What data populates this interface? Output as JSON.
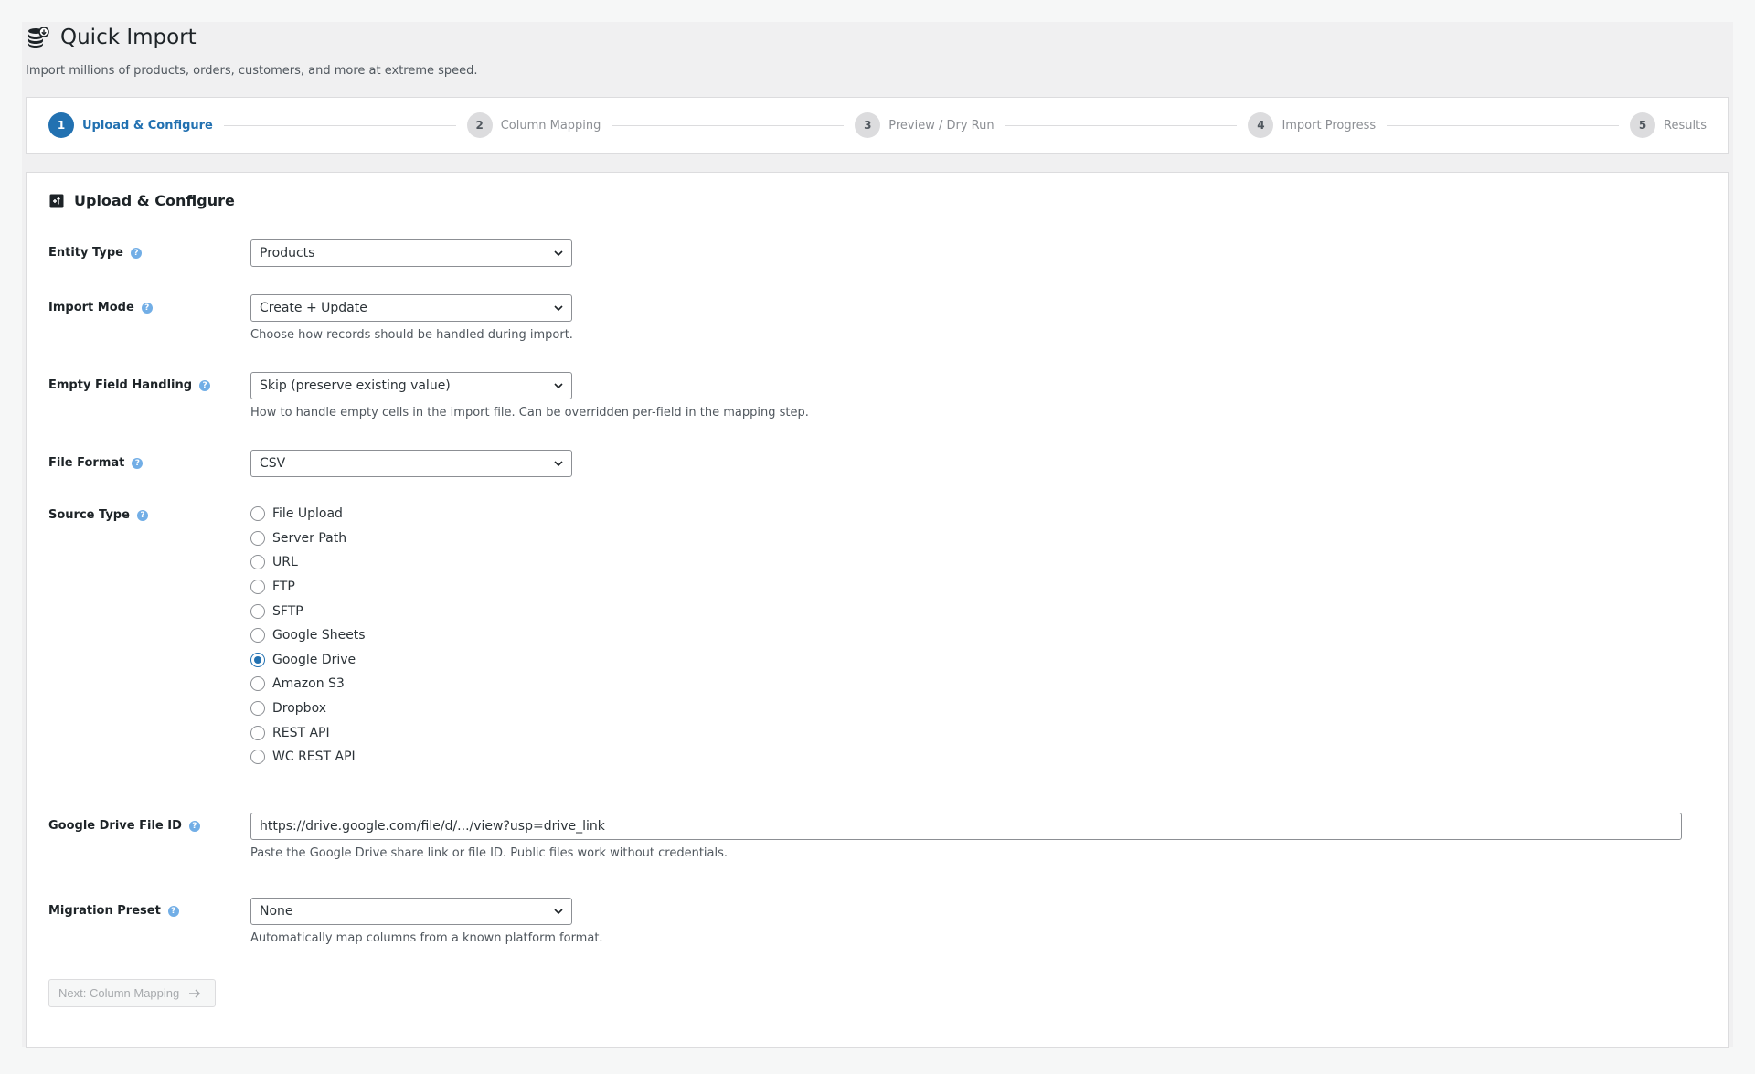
{
  "header": {
    "title": "Quick Import",
    "subtitle": "Import millions of products, orders, customers, and more at extreme speed.",
    "icon": "database-import-icon"
  },
  "stepper": {
    "steps": [
      {
        "num": "1",
        "label": "Upload & Configure",
        "active": true
      },
      {
        "num": "2",
        "label": "Column Mapping",
        "active": false
      },
      {
        "num": "3",
        "label": "Preview / Dry Run",
        "active": false
      },
      {
        "num": "4",
        "label": "Import Progress",
        "active": false
      },
      {
        "num": "5",
        "label": "Results",
        "active": false
      }
    ]
  },
  "card": {
    "title": "Upload & Configure",
    "icon": "upload-configure-icon"
  },
  "fields": {
    "entity_type": {
      "label": "Entity Type",
      "value": "Products"
    },
    "import_mode": {
      "label": "Import Mode",
      "value": "Create + Update",
      "description": "Choose how records should be handled during import."
    },
    "empty_field": {
      "label": "Empty Field Handling",
      "value": "Skip (preserve existing value)",
      "description": "How to handle empty cells in the import file. Can be overridden per-field in the mapping step."
    },
    "file_format": {
      "label": "File Format",
      "value": "CSV"
    },
    "source_type": {
      "label": "Source Type",
      "selected": "Google Drive",
      "options": [
        "File Upload",
        "Server Path",
        "URL",
        "FTP",
        "SFTP",
        "Google Sheets",
        "Google Drive",
        "Amazon S3",
        "Dropbox",
        "REST API",
        "WC REST API"
      ]
    },
    "drive_file_id": {
      "label": "Google Drive File ID",
      "value": "https://drive.google.com/file/d/.../view?usp=drive_link",
      "description": "Paste the Google Drive share link or file ID. Public files work without credentials."
    },
    "migration_preset": {
      "label": "Migration Preset",
      "value": "None",
      "description": "Automatically map columns from a known platform format."
    }
  },
  "actions": {
    "next_label": "Next: Column Mapping"
  },
  "colors": {
    "accent": "#2271b1",
    "help": "#72aee6"
  },
  "help_glyph": "?"
}
